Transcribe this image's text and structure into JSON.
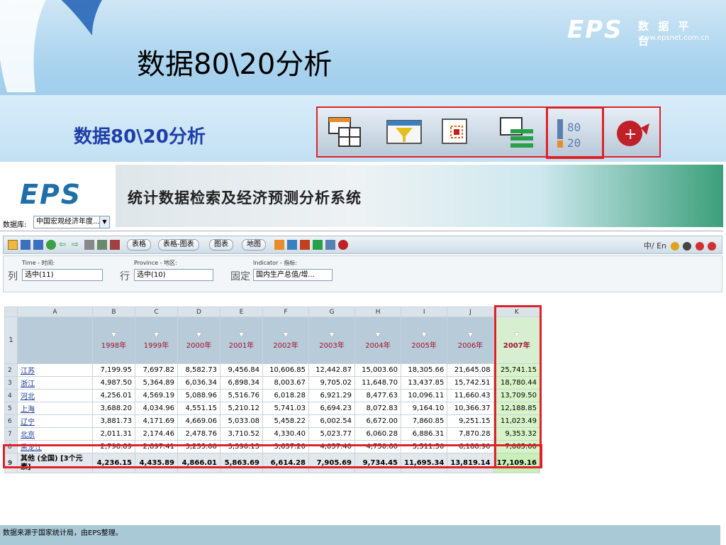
{
  "slide": {
    "title": "数据80\\20分析",
    "subtitle": "数据80\\20分析",
    "brand": {
      "logo": "EPS",
      "name_cn": "数 据 平 台",
      "url": "www.epsnet.com.cn"
    },
    "icons": [
      "table-icon",
      "filter-icon",
      "chart-select-icon",
      "list-icon",
      "pareto-8020-icon",
      "help-icon"
    ]
  },
  "app": {
    "logo": "EPS",
    "banner_title": "统计数据检索及经济预测分析系统",
    "database_label": "数据库:",
    "database_value": "中国宏观经济年度...",
    "toolbar": {
      "buttons": [
        "表格",
        "表格-图表",
        "图表",
        "地图"
      ],
      "lang": "中/ En"
    },
    "filters": {
      "col_label": "列",
      "row_label": "行",
      "fixed_label": "固定",
      "time_caption": "Time - 时间:",
      "province_caption": "Province - 地区:",
      "indicator_caption": "Indicator - 指标:",
      "time_value": "选中(11)",
      "province_value": "选中(10)",
      "indicator_value": "国内生产总值/增..."
    }
  },
  "sheet": {
    "columns": [
      "A",
      "B",
      "C",
      "D",
      "E",
      "F",
      "G",
      "H",
      "I",
      "J",
      "K"
    ],
    "years": [
      "1998年",
      "1999年",
      "2000年",
      "2001年",
      "2002年",
      "2003年",
      "2004年",
      "2005年",
      "2006年",
      "2007年"
    ],
    "rows": [
      {
        "n": "2",
        "name": "江苏",
        "values": [
          "7,199.95",
          "7,697.82",
          "8,582.73",
          "9,456.84",
          "10,606.85",
          "12,442.87",
          "15,003.60",
          "18,305.66",
          "21,645.08",
          "25,741.15"
        ]
      },
      {
        "n": "3",
        "name": "浙江",
        "values": [
          "4,987.50",
          "5,364.89",
          "6,036.34",
          "6,898.34",
          "8,003.67",
          "9,705.02",
          "11,648.70",
          "13,437.85",
          "15,742.51",
          "18,780.44"
        ]
      },
      {
        "n": "4",
        "name": "河北",
        "values": [
          "4,256.01",
          "4,569.19",
          "5,088.96",
          "5,516.76",
          "6,018.28",
          "6,921.29",
          "8,477.63",
          "10,096.11",
          "11,660.43",
          "13,709.50"
        ]
      },
      {
        "n": "5",
        "name": "上海",
        "values": [
          "3,688.20",
          "4,034.96",
          "4,551.15",
          "5,210.12",
          "5,741.03",
          "6,694.23",
          "8,072.83",
          "9,164.10",
          "10,366.37",
          "12,188.85"
        ]
      },
      {
        "n": "6",
        "name": "辽宁",
        "values": [
          "3,881.73",
          "4,171.69",
          "4,669.06",
          "5,033.08",
          "5,458.22",
          "6,002.54",
          "6,672.00",
          "7,860.85",
          "9,251.15",
          "11,023.49"
        ]
      },
      {
        "n": "7",
        "name": "北京",
        "values": [
          "2,011.31",
          "2,174.46",
          "2,478.76",
          "3,710.52",
          "4,330.40",
          "5,023.77",
          "6,060.28",
          "6,886.31",
          "7,870.28",
          "9,353.32"
        ]
      },
      {
        "n": "8",
        "name": "黑龙江",
        "values": [
          "2,798.89",
          "2,897.41",
          "3,253.00",
          "3,390.13",
          "3,637.20",
          "4,057.40",
          "4,750.60",
          "5,511.50",
          "6,188.90",
          "7,065.00"
        ]
      }
    ],
    "total": {
      "n": "9",
      "name": "其他 (全国) [3个元素]",
      "values": [
        "4,236.15",
        "4,435.89",
        "4,866.01",
        "5,863.69",
        "6,614.28",
        "7,905.69",
        "9,734.45",
        "11,695.34",
        "13,819.14",
        "17,109.16"
      ]
    }
  },
  "footer": "数据来源于国家统计局，由EPS整理。",
  "colors": {
    "highlight": "#e0212a",
    "accent": "#1f3fa8"
  }
}
